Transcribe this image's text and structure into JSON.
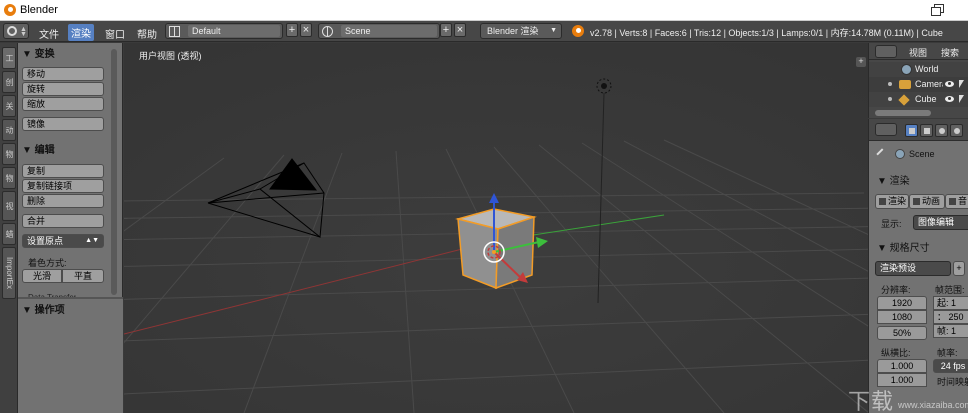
{
  "window": {
    "title": "Blender"
  },
  "infobar": {
    "menus": [
      "文件",
      "渲染",
      "窗口",
      "帮助"
    ],
    "layout_value": "Default",
    "scene_value": "Scene",
    "render_engine": "Blender 渲染",
    "stats": "v2.78 | Verts:8 | Faces:6 | Tris:12 | Objects:1/3 | Lamps:0/1 | 内存:14.78M (0.11M) | Cube",
    "add_symbol": "+",
    "close_symbol": "×"
  },
  "tool_tabs": [
    "工",
    "创",
    "关",
    "动",
    "物",
    "物",
    "视",
    "蜡",
    "ImportEx"
  ],
  "toolshelf": {
    "transform_header": "▼ 变换",
    "transform_buttons": [
      "移动",
      "旋转",
      "缩放"
    ],
    "mirror_button": "镜像",
    "edit_header": "▼ 编辑",
    "edit_buttons": [
      "复制",
      "复制链接项",
      "删除"
    ],
    "join_button": "合并",
    "origin_select": "设置原点",
    "shading_label": "着色方式:",
    "shading_smooth": "光滑",
    "shading_flat": "平直",
    "cut_label": "Data Transfer",
    "operator_header": "▼ 操作项"
  },
  "viewport": {
    "label": "用户视图 (透视)",
    "corner_symbol": "+"
  },
  "outliner": {
    "view_label": "视图",
    "search_label": "搜索",
    "items": [
      {
        "label": "World",
        "icon": "world-icon"
      },
      {
        "label": "Camera",
        "icon": "camera-icon"
      },
      {
        "label": "Cube",
        "icon": "cube-icon"
      }
    ]
  },
  "properties": {
    "scene_label": "Scene",
    "render_header": "▼ 渲染",
    "render_buttons": [
      "渲染",
      "动画",
      "音"
    ],
    "display_label": "显示:",
    "display_value": "图像编辑",
    "dimensions_header": "▼ 规格尺寸",
    "preset_value": "渲染预设",
    "resolution_label": "分辨率:",
    "res_x": "1920",
    "res_y": "1080",
    "res_pct": "50%",
    "frame_range_label": "帧范围:",
    "frame_start": "起: 1",
    "frame_end": "： 250",
    "frame_step": "帧: 1",
    "aspect_label": "纵横比:",
    "aspect_x": "1.000",
    "aspect_y": "1.000",
    "fps_label": "帧率:",
    "fps_value": "24 fps",
    "time_remap": "时间映射"
  },
  "watermark": {
    "big": "下载",
    "small": "www.xiazaiba.com"
  },
  "colors": {
    "accent": "#5680c2",
    "selection_outline": "#f39c26",
    "axis_x": "#c33b3b",
    "axis_y": "#3cbf3c",
    "axis_z": "#2f55d6"
  }
}
